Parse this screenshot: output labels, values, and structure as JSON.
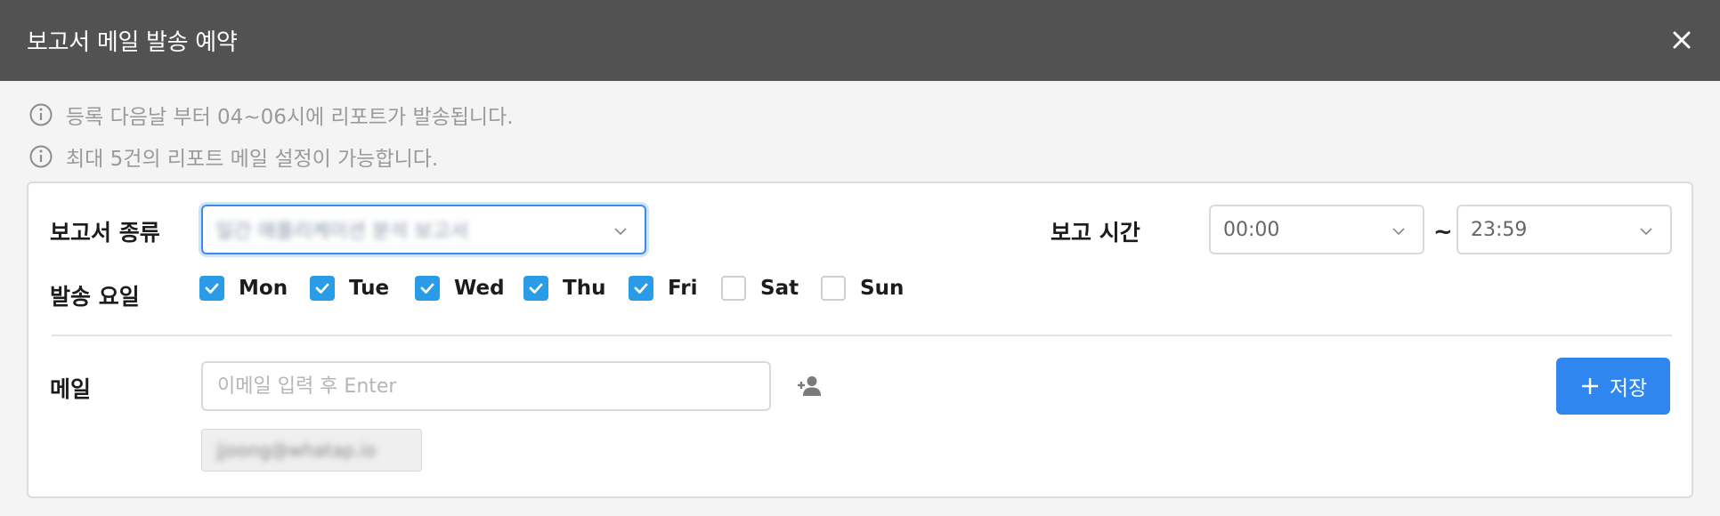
{
  "dialog": {
    "title": "보고서 메일 발송 예약",
    "close_icon": "close-icon"
  },
  "notices": [
    "등록 다음날 부터 04~06시에 리포트가 발송됩니다.",
    "최대 5건의 리포트 메일 설정이 가능합니다."
  ],
  "form": {
    "report_type_label": "보고서 종류",
    "report_type_value": "일간 애플리케이션 분석 보고서",
    "report_time_label": "보고 시간",
    "time_from": "00:00",
    "time_separator": "~",
    "time_to": "23:59",
    "send_days_label": "발송 요일",
    "days": [
      {
        "label": "Mon",
        "checked": true
      },
      {
        "label": "Tue",
        "checked": true
      },
      {
        "label": "Wed",
        "checked": true
      },
      {
        "label": "Thu",
        "checked": true
      },
      {
        "label": "Fri",
        "checked": true
      },
      {
        "label": "Sat",
        "checked": false
      },
      {
        "label": "Sun",
        "checked": false
      }
    ],
    "email_label": "메일",
    "email_placeholder": "이메일 입력 후 Enter",
    "add_user_icon": "add-user-icon",
    "email_chip": "jjoong@whatap.io",
    "save_label": "저장"
  },
  "colors": {
    "header_bg": "#525252",
    "accent": "#2f86ee",
    "checkbox": "#2a9be6"
  }
}
